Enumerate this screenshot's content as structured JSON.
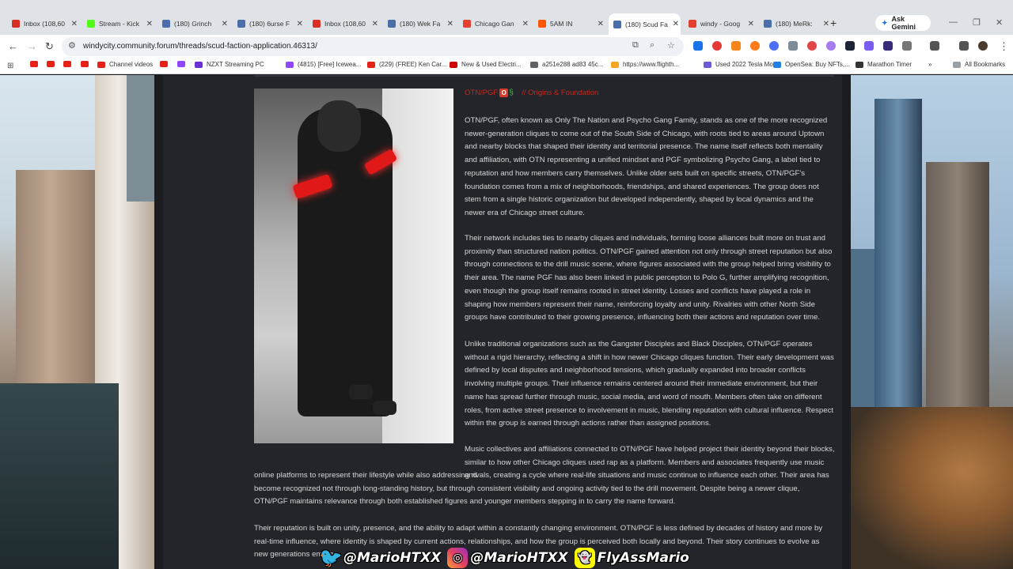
{
  "browser": {
    "tabs": [
      {
        "title": "Inbox (108,60",
        "icon": "gmail-icon",
        "color": "#d93025"
      },
      {
        "title": "Stream - Kick",
        "icon": "kick-icon",
        "color": "#53fc18"
      },
      {
        "title": "(180) Grinch",
        "icon": "forum-icon",
        "color": "#4a6ea9"
      },
      {
        "title": "(180) 6urse F",
        "icon": "forum-icon",
        "color": "#4a6ea9"
      },
      {
        "title": "Inbox (108,60",
        "icon": "gmail-icon",
        "color": "#d93025"
      },
      {
        "title": "(180) Wek Fa",
        "icon": "forum-icon",
        "color": "#4a6ea9"
      },
      {
        "title": "Chicago Gan",
        "icon": "map-pin-icon",
        "color": "#e4402f"
      },
      {
        "title": "5AM IN",
        "icon": "soundcloud-icon",
        "color": "#ff5500"
      },
      {
        "title": "(180) Scud Fa",
        "icon": "forum-icon",
        "color": "#4a6ea9",
        "active": true
      },
      {
        "title": "windy - Goog",
        "icon": "map-pin-icon",
        "color": "#e4402f"
      },
      {
        "title": "(180) MeRk:",
        "icon": "forum-icon",
        "color": "#4a6ea9"
      }
    ],
    "new_tab": "+",
    "gemini_label": "Ask Gemini",
    "url": "windycity.community.forum/threads/scud-faction-application.46313/",
    "bookmarks": [
      {
        "label": "",
        "type": "yt"
      },
      {
        "label": "",
        "type": "yt"
      },
      {
        "label": "",
        "type": "yt"
      },
      {
        "label": "",
        "type": "yt"
      },
      {
        "label": "Channel videos",
        "type": "yt"
      },
      {
        "label": "",
        "type": "yt"
      },
      {
        "label": "",
        "type": "twitch"
      },
      {
        "label": "NZXT Streaming PC",
        "type": "nzxt"
      },
      {
        "label": "(4815) [Free] Icewea...",
        "type": "twitch"
      },
      {
        "label": "(229) (FREE) Ken Car...",
        "type": "yt"
      },
      {
        "label": "New & Used Electri...",
        "type": "tesla"
      },
      {
        "label": "a251e288 ad83 45c...",
        "type": "web"
      },
      {
        "label": "https://www.flighth...",
        "type": "flight"
      },
      {
        "label": "Used 2022 Tesla Mo...",
        "type": "car"
      },
      {
        "label": "OpenSea: Buy NFTs,...",
        "type": "opensea"
      },
      {
        "label": "Marathon Timer",
        "type": "timer"
      }
    ],
    "more_bookmarks": "»",
    "all_bookmarks": "All Bookmarks"
  },
  "post": {
    "heading_prefix": "OTN/PGF",
    "heading_suffix": "// Origins & Foundation",
    "paragraphs": [
      "OTN/PGF, often known as Only The Nation and Psycho Gang Family, stands as one of the more recognized newer-generation cliques to come out of the South Side of Chicago, with roots tied to areas around Uptown and nearby blocks that shaped their identity and territorial presence. The name itself reflects both mentality and affiliation, with OTN representing a unified mindset and PGF symbolizing Psycho Gang, a label tied to reputation and how members carry themselves. Unlike older sets built on specific streets, OTN/PGF's foundation comes from a mix of neighborhoods, friendships, and shared experiences. The group does not stem from a single historic organization but developed independently, shaped by local dynamics and the newer era of Chicago street culture.",
      "Their network includes ties to nearby cliques and individuals, forming loose alliances built more on trust and proximity than structured nation politics. OTN/PGF gained attention not only through street reputation but also through connections to the drill music scene, where figures associated with the group helped bring visibility to their area. The name PGF has also been linked in public perception to Polo G, further amplifying recognition, even though the group itself remains rooted in street identity. Losses and conflicts have played a role in shaping how members represent their name, reinforcing loyalty and unity. Rivalries with other North Side groups have contributed to their growing presence, influencing both their actions and reputation over time.",
      "Unlike traditional organizations such as the Gangster Disciples and Black Disciples, OTN/PGF operates without a rigid hierarchy, reflecting a shift in how newer Chicago cliques function. Their early development was defined by local disputes and neighborhood tensions, which gradually expanded into broader conflicts involving multiple groups. Their influence remains centered around their immediate environment, but their name has spread further through music, social media, and word of mouth. Members often take on different roles, from active street presence to involvement in music, blending reputation with cultural influence. Respect within the group is earned through actions rather than assigned positions.",
      "Music collectives and affiliations connected to OTN/PGF have helped project their identity beyond their blocks, similar to how other Chicago cliques used rap as a platform. Members and associates frequently use music and",
      "online platforms to represent their lifestyle while also addressing rivals, creating a cycle where real-life situations and music continue to influence each other. Their area has become recognized not through long-standing history, but through consistent visibility and ongoing activity tied to the drill movement. Despite being a newer clique, OTN/PGF maintains relevance through both established figures and younger members stepping in to carry the name forward.",
      "Their reputation is built on unity, presence, and the ability to adapt within a constantly changing environment. OTN/PGF is less defined by decades of history and more by real-time influence, where identity is shaped by current actions, relationships, and how the group is perceived both locally and beyond. Their story continues to evolve as new generations emerge"
    ]
  },
  "overlay": {
    "twitter": "@MarioHTXX",
    "instagram": "@MarioHTXX",
    "snapchat": "FlyAssMario"
  }
}
